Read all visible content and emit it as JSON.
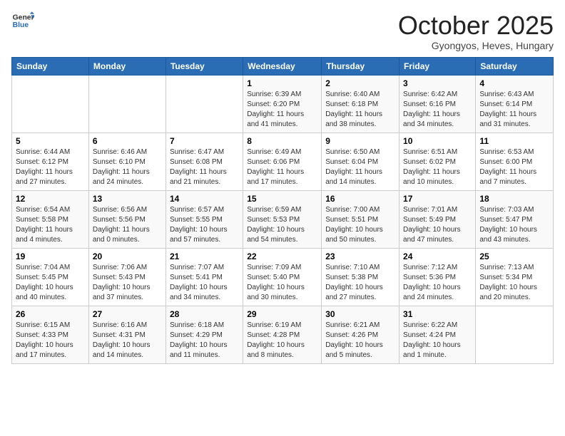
{
  "header": {
    "logo_line1": "General",
    "logo_line2": "Blue",
    "month": "October 2025",
    "location": "Gyongyos, Heves, Hungary"
  },
  "weekdays": [
    "Sunday",
    "Monday",
    "Tuesday",
    "Wednesday",
    "Thursday",
    "Friday",
    "Saturday"
  ],
  "weeks": [
    [
      {
        "day": "",
        "info": ""
      },
      {
        "day": "",
        "info": ""
      },
      {
        "day": "",
        "info": ""
      },
      {
        "day": "1",
        "info": "Sunrise: 6:39 AM\nSunset: 6:20 PM\nDaylight: 11 hours and 41 minutes."
      },
      {
        "day": "2",
        "info": "Sunrise: 6:40 AM\nSunset: 6:18 PM\nDaylight: 11 hours and 38 minutes."
      },
      {
        "day": "3",
        "info": "Sunrise: 6:42 AM\nSunset: 6:16 PM\nDaylight: 11 hours and 34 minutes."
      },
      {
        "day": "4",
        "info": "Sunrise: 6:43 AM\nSunset: 6:14 PM\nDaylight: 11 hours and 31 minutes."
      }
    ],
    [
      {
        "day": "5",
        "info": "Sunrise: 6:44 AM\nSunset: 6:12 PM\nDaylight: 11 hours and 27 minutes."
      },
      {
        "day": "6",
        "info": "Sunrise: 6:46 AM\nSunset: 6:10 PM\nDaylight: 11 hours and 24 minutes."
      },
      {
        "day": "7",
        "info": "Sunrise: 6:47 AM\nSunset: 6:08 PM\nDaylight: 11 hours and 21 minutes."
      },
      {
        "day": "8",
        "info": "Sunrise: 6:49 AM\nSunset: 6:06 PM\nDaylight: 11 hours and 17 minutes."
      },
      {
        "day": "9",
        "info": "Sunrise: 6:50 AM\nSunset: 6:04 PM\nDaylight: 11 hours and 14 minutes."
      },
      {
        "day": "10",
        "info": "Sunrise: 6:51 AM\nSunset: 6:02 PM\nDaylight: 11 hours and 10 minutes."
      },
      {
        "day": "11",
        "info": "Sunrise: 6:53 AM\nSunset: 6:00 PM\nDaylight: 11 hours and 7 minutes."
      }
    ],
    [
      {
        "day": "12",
        "info": "Sunrise: 6:54 AM\nSunset: 5:58 PM\nDaylight: 11 hours and 4 minutes."
      },
      {
        "day": "13",
        "info": "Sunrise: 6:56 AM\nSunset: 5:56 PM\nDaylight: 11 hours and 0 minutes."
      },
      {
        "day": "14",
        "info": "Sunrise: 6:57 AM\nSunset: 5:55 PM\nDaylight: 10 hours and 57 minutes."
      },
      {
        "day": "15",
        "info": "Sunrise: 6:59 AM\nSunset: 5:53 PM\nDaylight: 10 hours and 54 minutes."
      },
      {
        "day": "16",
        "info": "Sunrise: 7:00 AM\nSunset: 5:51 PM\nDaylight: 10 hours and 50 minutes."
      },
      {
        "day": "17",
        "info": "Sunrise: 7:01 AM\nSunset: 5:49 PM\nDaylight: 10 hours and 47 minutes."
      },
      {
        "day": "18",
        "info": "Sunrise: 7:03 AM\nSunset: 5:47 PM\nDaylight: 10 hours and 43 minutes."
      }
    ],
    [
      {
        "day": "19",
        "info": "Sunrise: 7:04 AM\nSunset: 5:45 PM\nDaylight: 10 hours and 40 minutes."
      },
      {
        "day": "20",
        "info": "Sunrise: 7:06 AM\nSunset: 5:43 PM\nDaylight: 10 hours and 37 minutes."
      },
      {
        "day": "21",
        "info": "Sunrise: 7:07 AM\nSunset: 5:41 PM\nDaylight: 10 hours and 34 minutes."
      },
      {
        "day": "22",
        "info": "Sunrise: 7:09 AM\nSunset: 5:40 PM\nDaylight: 10 hours and 30 minutes."
      },
      {
        "day": "23",
        "info": "Sunrise: 7:10 AM\nSunset: 5:38 PM\nDaylight: 10 hours and 27 minutes."
      },
      {
        "day": "24",
        "info": "Sunrise: 7:12 AM\nSunset: 5:36 PM\nDaylight: 10 hours and 24 minutes."
      },
      {
        "day": "25",
        "info": "Sunrise: 7:13 AM\nSunset: 5:34 PM\nDaylight: 10 hours and 20 minutes."
      }
    ],
    [
      {
        "day": "26",
        "info": "Sunrise: 6:15 AM\nSunset: 4:33 PM\nDaylight: 10 hours and 17 minutes."
      },
      {
        "day": "27",
        "info": "Sunrise: 6:16 AM\nSunset: 4:31 PM\nDaylight: 10 hours and 14 minutes."
      },
      {
        "day": "28",
        "info": "Sunrise: 6:18 AM\nSunset: 4:29 PM\nDaylight: 10 hours and 11 minutes."
      },
      {
        "day": "29",
        "info": "Sunrise: 6:19 AM\nSunset: 4:28 PM\nDaylight: 10 hours and 8 minutes."
      },
      {
        "day": "30",
        "info": "Sunrise: 6:21 AM\nSunset: 4:26 PM\nDaylight: 10 hours and 5 minutes."
      },
      {
        "day": "31",
        "info": "Sunrise: 6:22 AM\nSunset: 4:24 PM\nDaylight: 10 hours and 1 minute."
      },
      {
        "day": "",
        "info": ""
      }
    ]
  ]
}
